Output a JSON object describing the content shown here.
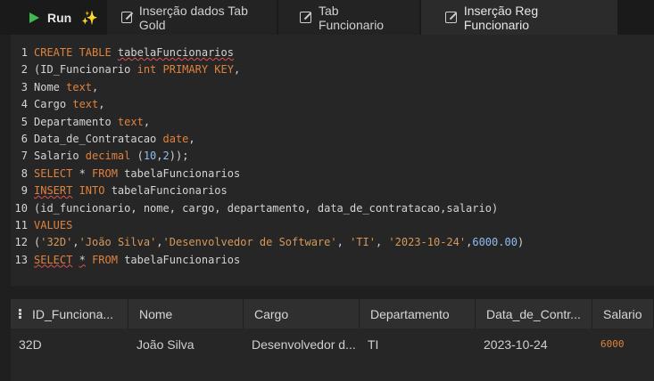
{
  "toolbar": {
    "run_label": "Run",
    "tabs": [
      {
        "label": "Inserção dados Tab Gold"
      },
      {
        "label": "Tab Funcionario"
      },
      {
        "label": "Inserção Reg Funcionario"
      }
    ]
  },
  "editor": {
    "lines": [
      {
        "n": "1",
        "segs": [
          [
            "kw",
            "CREATE TABLE "
          ],
          [
            "sq",
            "tabelaFuncionarios"
          ]
        ]
      },
      {
        "n": "2",
        "segs": [
          [
            "",
            "(ID_Funcionario "
          ],
          [
            "kw",
            "int PRIMARY KEY"
          ],
          [
            "",
            ","
          ]
        ]
      },
      {
        "n": "3",
        "segs": [
          [
            "",
            "Nome "
          ],
          [
            "kw",
            "text"
          ],
          [
            "",
            ","
          ]
        ]
      },
      {
        "n": "4",
        "segs": [
          [
            "",
            "Cargo "
          ],
          [
            "kw",
            "text"
          ],
          [
            "",
            ","
          ]
        ]
      },
      {
        "n": "5",
        "segs": [
          [
            "",
            "Departamento "
          ],
          [
            "kw",
            "text"
          ],
          [
            "",
            ","
          ]
        ]
      },
      {
        "n": "6",
        "segs": [
          [
            "",
            "Data_de_Contratacao "
          ],
          [
            "kw",
            "date"
          ],
          [
            "",
            ","
          ]
        ]
      },
      {
        "n": "7",
        "segs": [
          [
            "",
            "Salario "
          ],
          [
            "kw",
            "decimal"
          ],
          [
            "",
            " ("
          ],
          [
            "num",
            "10"
          ],
          [
            "",
            ","
          ],
          [
            "num",
            "2"
          ],
          [
            "",
            "));"
          ]
        ]
      },
      {
        "n": "8",
        "segs": [
          [
            "kw",
            "SELECT"
          ],
          [
            "",
            " * "
          ],
          [
            "kw",
            "FROM"
          ],
          [
            "",
            " tabelaFuncionarios"
          ]
        ]
      },
      {
        "n": "9",
        "segs": [
          [
            "kw sq",
            "INSERT"
          ],
          [
            "kw",
            " INTO"
          ],
          [
            "",
            " tabelaFuncionarios"
          ]
        ]
      },
      {
        "n": "10",
        "segs": [
          [
            "",
            "(id_funcionario, nome, cargo, departamento, data_de_contratacao,salario)"
          ]
        ]
      },
      {
        "n": "11",
        "segs": [
          [
            "kw",
            "VALUES"
          ]
        ]
      },
      {
        "n": "12",
        "segs": [
          [
            "",
            "("
          ],
          [
            "str",
            "'32D'"
          ],
          [
            "",
            ","
          ],
          [
            "str",
            "'João Silva'"
          ],
          [
            "",
            ","
          ],
          [
            "str",
            "'Desenvolvedor de Software'"
          ],
          [
            "",
            ", "
          ],
          [
            "str",
            "'TI'"
          ],
          [
            "",
            ", "
          ],
          [
            "str",
            "'2023-10-24'"
          ],
          [
            "",
            ","
          ],
          [
            "num",
            "6000.00"
          ],
          [
            "",
            ")"
          ]
        ]
      },
      {
        "n": "13",
        "segs": [
          [
            "kw sq",
            "SELECT"
          ],
          [
            "",
            " "
          ],
          [
            "sq",
            "*"
          ],
          [
            "",
            " "
          ],
          [
            "kw",
            "FROM"
          ],
          [
            "",
            " tabelaFuncionarios"
          ]
        ]
      }
    ]
  },
  "results": {
    "headers": [
      "ID_Funciona...",
      "Nome",
      "Cargo",
      "Departamento",
      "Data_de_Contr...",
      "Salario"
    ],
    "rows": [
      [
        "32D",
        "João Silva",
        "Desenvolvedor d...",
        "TI",
        "2023-10-24",
        "6000"
      ]
    ]
  }
}
